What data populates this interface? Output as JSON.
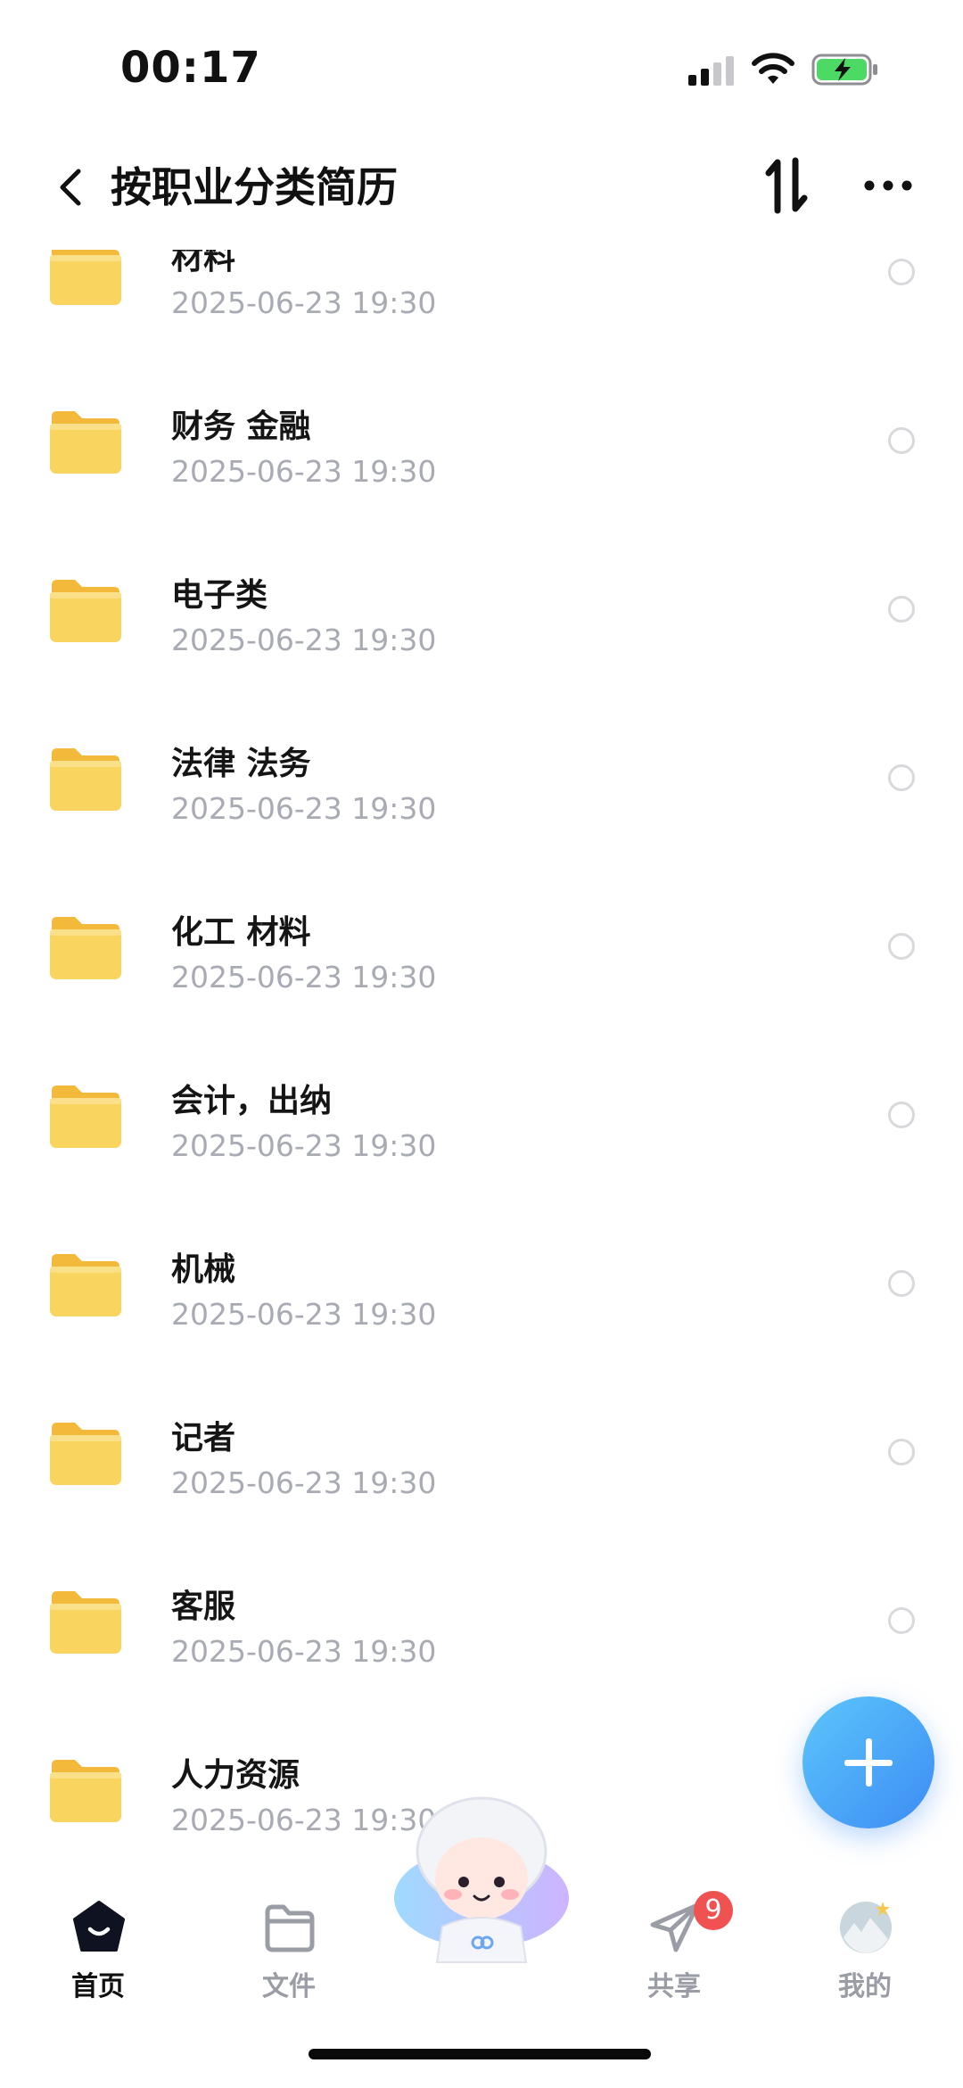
{
  "status": {
    "time": "00:17"
  },
  "header": {
    "title": "按职业分类简历"
  },
  "items": [
    {
      "name": "材料",
      "date": "2025-06-23 19:30"
    },
    {
      "name": "财务 金融",
      "date": "2025-06-23 19:30"
    },
    {
      "name": "电子类",
      "date": "2025-06-23 19:30"
    },
    {
      "name": "法律 法务",
      "date": "2025-06-23 19:30"
    },
    {
      "name": "化工 材料",
      "date": "2025-06-23 19:30"
    },
    {
      "name": "会计，出纳",
      "date": "2025-06-23 19:30"
    },
    {
      "name": "机械",
      "date": "2025-06-23 19:30"
    },
    {
      "name": "记者",
      "date": "2025-06-23 19:30"
    },
    {
      "name": "客服",
      "date": "2025-06-23 19:30"
    },
    {
      "name": "人力资源",
      "date": "2025-06-23 19:30"
    }
  ],
  "tabs": [
    {
      "label": "首页",
      "icon": "home-icon"
    },
    {
      "label": "文件",
      "icon": "folder-icon"
    },
    {
      "label": "共享",
      "icon": "send-icon",
      "badge": "9"
    },
    {
      "label": "我的",
      "icon": "avatar"
    }
  ],
  "colors": {
    "accent": "#3d8cf4",
    "folder": "#f7cf55",
    "badge": "#f05252"
  }
}
